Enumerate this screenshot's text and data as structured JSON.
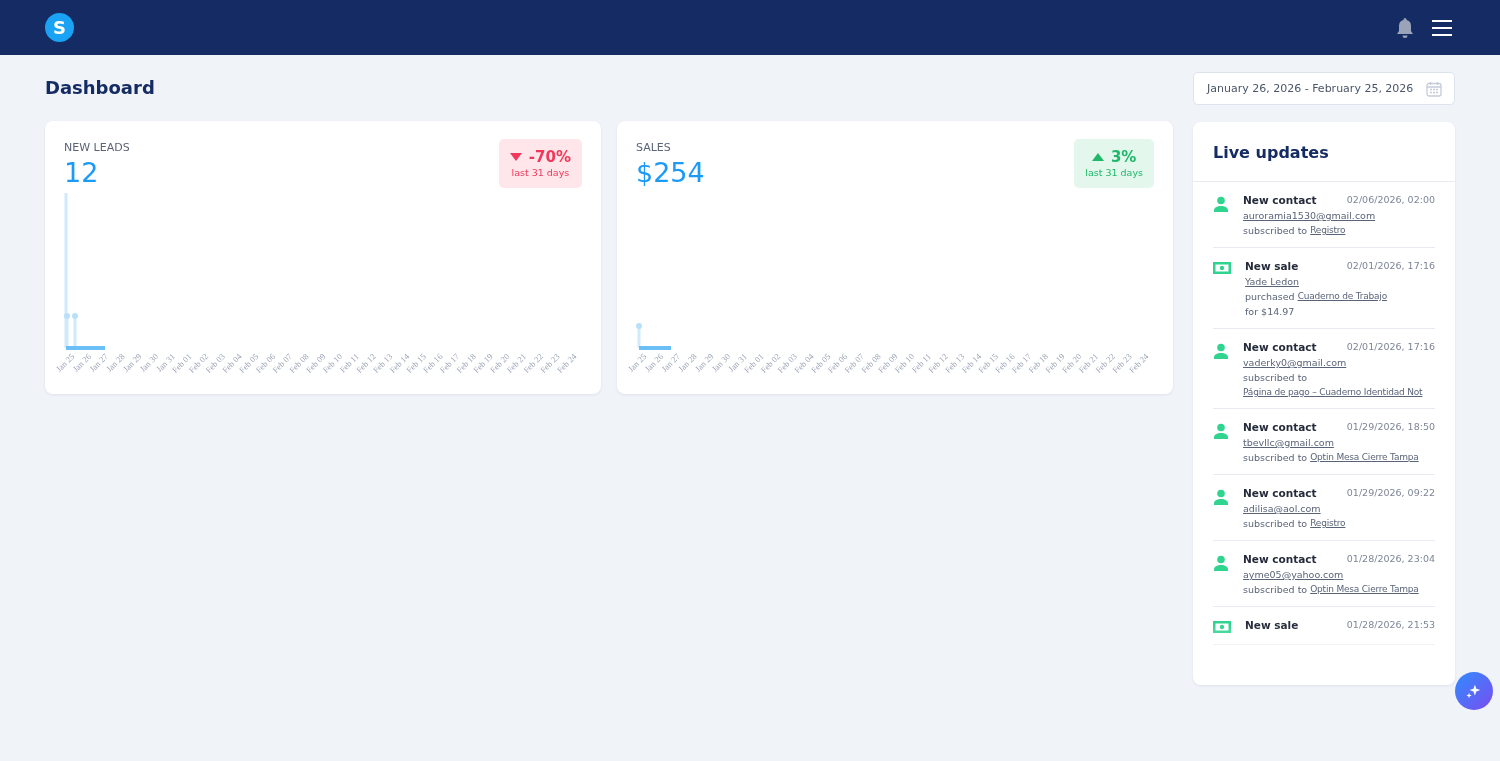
{
  "header": {
    "logo": "S"
  },
  "page": {
    "title": "Dashboard",
    "date_range": "January 26, 2026 - February 25, 2026"
  },
  "cards": [
    {
      "label": "NEW LEADS",
      "value": "12",
      "change": {
        "kind": "down",
        "value": "-70%",
        "period": "last 31 days"
      },
      "x_labels": [
        "Jan 25",
        "Jan 26",
        "Jan 27",
        "Jan 28",
        "Jan 29",
        "Jan 30",
        "Jan 31",
        "Feb 01",
        "Feb 02",
        "Feb 03",
        "Feb 04",
        "Feb 05",
        "Feb 06",
        "Feb 07",
        "Feb 08",
        "Feb 09",
        "Feb 10",
        "Feb 11",
        "Feb 12",
        "Feb 13",
        "Feb 14",
        "Feb 15",
        "Feb 16",
        "Feb 17",
        "Feb 18",
        "Feb 19",
        "Feb 20",
        "Feb 21",
        "Feb 22",
        "Feb 23",
        "Feb 24"
      ]
    },
    {
      "label": "SALES",
      "value": "$254",
      "change": {
        "kind": "up",
        "value": "3%",
        "period": "last 31 days"
      },
      "x_labels": [
        "Jan 25",
        "Jan 26",
        "Jan 27",
        "Jan 28",
        "Jan 29",
        "Jan 30",
        "Jan 31",
        "Feb 01",
        "Feb 02",
        "Feb 03",
        "Feb 04",
        "Feb 05",
        "Feb 06",
        "Feb 07",
        "Feb 08",
        "Feb 09",
        "Feb 10",
        "Feb 11",
        "Feb 12",
        "Feb 13",
        "Feb 14",
        "Feb 15",
        "Feb 16",
        "Feb 17",
        "Feb 18",
        "Feb 19",
        "Feb 20",
        "Feb 21",
        "Feb 22",
        "Feb 23",
        "Feb 24"
      ]
    }
  ],
  "live_updates": {
    "title": "Live updates",
    "items": [
      {
        "kind": "contact",
        "title": "New contact",
        "time": "02/06/2026, 02:00",
        "subject": "auroramia1530@gmail.com",
        "prefix": "subscribed to",
        "link": "Registro"
      },
      {
        "kind": "sale",
        "title": "New sale",
        "time": "02/01/2026, 17:16",
        "subject": "Yade Ledon",
        "prefix": "purchased",
        "link": "Cuaderno de Trabajo",
        "suffix": "for $14.97"
      },
      {
        "kind": "contact",
        "title": "New contact",
        "time": "02/01/2026, 17:16",
        "subject": "vaderky0@gmail.com",
        "prefix": "subscribed to",
        "link": "Página de pago – Cuaderno Identidad Not"
      },
      {
        "kind": "contact",
        "title": "New contact",
        "time": "01/29/2026, 18:50",
        "subject": "tbevllc@gmail.com",
        "prefix": "subscribed to",
        "link": "Optin Mesa Cierre Tampa"
      },
      {
        "kind": "contact",
        "title": "New contact",
        "time": "01/29/2026, 09:22",
        "subject": "adilisa@aol.com",
        "prefix": "subscribed to",
        "link": "Registro"
      },
      {
        "kind": "contact",
        "title": "New contact",
        "time": "01/28/2026, 23:04",
        "subject": "ayme05@yahoo.com",
        "prefix": "subscribed to",
        "link": "Optin Mesa Cierre Tampa"
      },
      {
        "kind": "sale",
        "title": "New sale",
        "time": "01/28/2026, 21:53"
      }
    ]
  }
}
